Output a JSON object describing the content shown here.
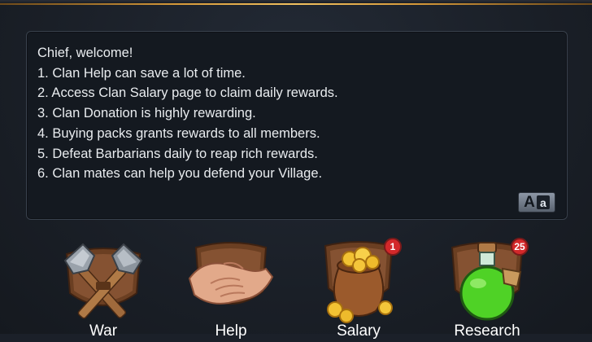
{
  "notice": {
    "lines": [
      "Chief, welcome!",
      "1. Clan Help can save a lot of time.",
      "2. Access Clan Salary page to claim daily rewards.",
      "3. Clan Donation is highly rewarding.",
      "4. Buying packs grants rewards to all members.",
      "5. Defeat Barbarians daily to reap rich rewards.",
      "6. Clan mates can help you defend your Village."
    ],
    "translate_button": {
      "big": "A",
      "small": "a",
      "icon": "translate-icon"
    }
  },
  "features": [
    {
      "label": "War",
      "icon": "crossed-axes-icon",
      "badge": null
    },
    {
      "label": "Help",
      "icon": "handshake-icon",
      "badge": null
    },
    {
      "label": "Salary",
      "icon": "gold-coin-sack-icon",
      "badge": "1"
    },
    {
      "label": "Research",
      "icon": "green-potion-icon",
      "badge": "25"
    }
  ],
  "colors": {
    "accent_gold": "#d79a3a",
    "badge_red": "#d3282a",
    "panel": "#141920",
    "text": "#e9ecef"
  }
}
